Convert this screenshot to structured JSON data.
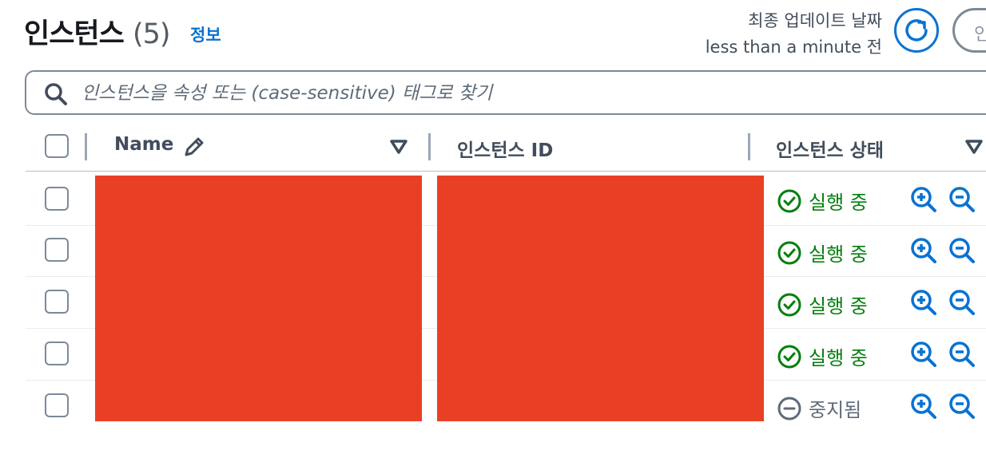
{
  "header": {
    "title": "인스턴스",
    "count": "(5)",
    "info_link": "정보",
    "updated_label": "최종 업데이트 날짜",
    "updated_value": "less than a minute 전",
    "partial_button_label": "인"
  },
  "search": {
    "placeholder": "인스턴스을 속성 또는 (case-sensitive) 태그로 찾기"
  },
  "table": {
    "columns": [
      {
        "label": "Name"
      },
      {
        "label": "인스턴스 ID"
      },
      {
        "label": "인스턴스 상태"
      }
    ],
    "rows": [
      {
        "status": "실행 중",
        "state": "running"
      },
      {
        "status": "실행 중",
        "state": "running"
      },
      {
        "status": "실행 중",
        "state": "running"
      },
      {
        "status": "실행 중",
        "state": "running"
      },
      {
        "status": "중지됨",
        "state": "stopped"
      }
    ]
  },
  "colors": {
    "accent": "#0972d3",
    "running": "#037f0c",
    "stopped": "#5f6b7a",
    "redaction": "#e94025"
  },
  "icons": [
    "refresh-icon",
    "search-icon",
    "edit-icon",
    "sort-down-icon",
    "check-circle-icon",
    "minus-circle-icon",
    "zoom-in-icon",
    "zoom-out-icon"
  ]
}
